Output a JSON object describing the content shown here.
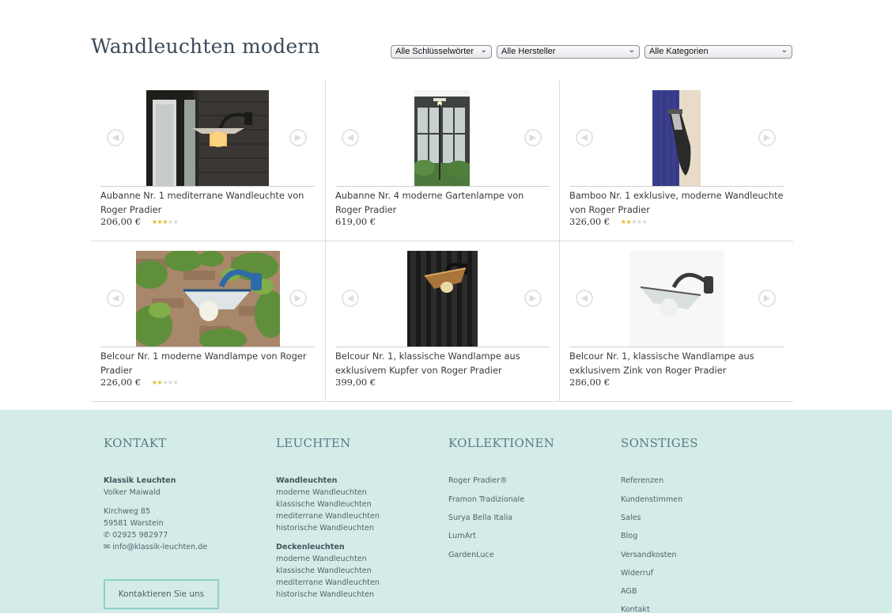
{
  "page": {
    "title": "Wandleuchten modern"
  },
  "filters": [
    {
      "selected": "Alle Schlüsselwörter"
    },
    {
      "selected": "Alle Hersteller"
    },
    {
      "selected": "Alle Kategorien"
    }
  ],
  "products": [
    {
      "title": "Aubanne Nr. 1 mediterrane Wandleuchte von Roger Pradier",
      "price": "206,00 €",
      "rating": 3
    },
    {
      "title": "Aubanne Nr. 4 moderne Gartenlampe von Roger Pradier",
      "price": "619,00 €",
      "rating": 0
    },
    {
      "title": "Bamboo Nr. 1 exklusive, moderne Wandleuchte von Roger Pradier",
      "price": "326,00 €",
      "rating": 2
    },
    {
      "title": "Belcour Nr. 1 moderne Wandlampe von Roger Pradier",
      "price": "226,00 €",
      "rating": 2
    },
    {
      "title": "Belcour Nr. 1, klassische Wandlampe aus exklusivem Kupfer von Roger Pradier",
      "price": "399,00 €",
      "rating": 0
    },
    {
      "title": "Belcour Nr. 1, klassische Wandlampe aus exklusivem Zink von Roger Pradier",
      "price": "286,00 €",
      "rating": 0
    }
  ],
  "icons": {
    "carousel_prev": "chevron-left-icon",
    "carousel_next": "chevron-right-icon",
    "phone": "phone-icon",
    "email": "envelope-icon",
    "star": "star-icon"
  },
  "footer": {
    "kontakt": {
      "heading": "KONTAKT",
      "company": "Klassik Leuchten",
      "person": "Volker Maiwald",
      "street": "Kirchweg 85",
      "city": "59581 Warstein",
      "phone": "02925 982977",
      "email": "info@klassik-leuchten.de",
      "button": "Kontaktieren Sie uns"
    },
    "leuchten": {
      "heading": "LEUCHTEN",
      "group1": "Wandleuchten",
      "group1_items": [
        "moderne Wandleuchten",
        "klassische Wandleuchten",
        "mediterrane Wandleuchten",
        "historische Wandleuchten"
      ],
      "group2": "Deckenleuchten",
      "group2_items": [
        "moderne Wandleuchten",
        "klassische Wandleuchten",
        "mediterrane Wandleuchten",
        "historische Wandleuchten"
      ]
    },
    "kollektionen": {
      "heading": "KOLLEKTIONEN",
      "items": [
        "Roger Pradier®",
        "Framon Tradizionale",
        "Surya Bella Italia",
        "LumArt",
        "GardenLuce"
      ]
    },
    "sonstiges": {
      "heading": "SONSTIGES",
      "items": [
        "Referenzen",
        "Kundenstimmen",
        "Sales",
        "Blog",
        "Versandkosten",
        "Widerruf",
        "AGB",
        "Kontakt"
      ]
    }
  },
  "colors": {
    "footer_bg": "#d3ece8",
    "button_border": "#8fd0c6",
    "heading": "#3b4a5a",
    "star": "#e6b51f"
  }
}
